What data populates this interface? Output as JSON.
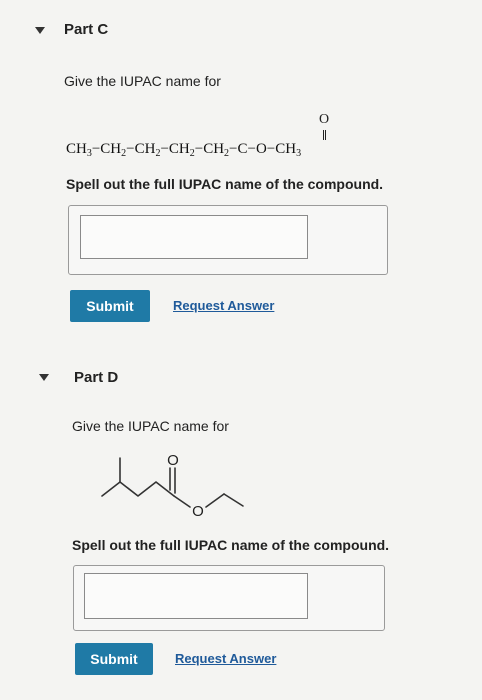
{
  "partC": {
    "title": "Part C",
    "prompt": "Give the IUPAC name for",
    "formula": {
      "carbonyl_o": "O",
      "segments": [
        "CH",
        "3",
        "−CH",
        "2",
        "−CH",
        "2",
        "−CH",
        "2",
        "−CH",
        "2",
        "−C−O−CH",
        "3"
      ]
    },
    "instruction": "Spell out the full IUPAC name of the compound.",
    "answer_value": "",
    "submit_label": "Submit",
    "request_label": "Request Answer"
  },
  "partD": {
    "title": "Part D",
    "prompt": "Give the IUPAC name for",
    "structure": {
      "carbonyl_o": "O",
      "ester_o": "O"
    },
    "instruction": "Spell out the full IUPAC name of the compound.",
    "answer_value": "",
    "submit_label": "Submit",
    "request_label": "Request Answer"
  },
  "colors": {
    "submit_bg": "#1f7aa6",
    "link": "#1f5a9a",
    "background": "#f4f4f2"
  },
  "icons": {
    "collapse_caret": "caret-down-icon"
  }
}
